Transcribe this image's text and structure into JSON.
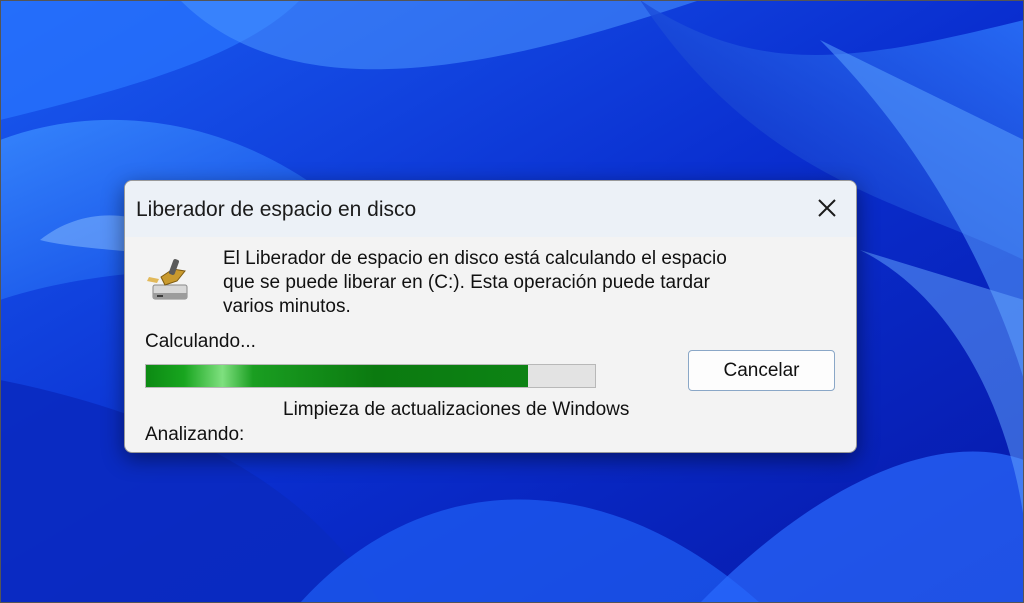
{
  "window": {
    "title": "Liberador de espacio en disco",
    "close_icon": "close-icon"
  },
  "content": {
    "icon": "disk-cleanup-icon",
    "message_line1": "El Liberador de espacio en disco está calculando el espacio",
    "message_line2": "que se puede liberar en  (C:). Esta operación puede tardar",
    "message_line3": "varios minutos.",
    "status": "Calculando...",
    "progress": 0.85,
    "current_item": "Limpieza de actualizaciones de Windows",
    "analyzing_label": "Analizando:"
  },
  "buttons": {
    "cancel": "Cancelar"
  },
  "colors": {
    "progress_fill": "#0b7a10",
    "wallpaper": "#0a2fd0"
  }
}
